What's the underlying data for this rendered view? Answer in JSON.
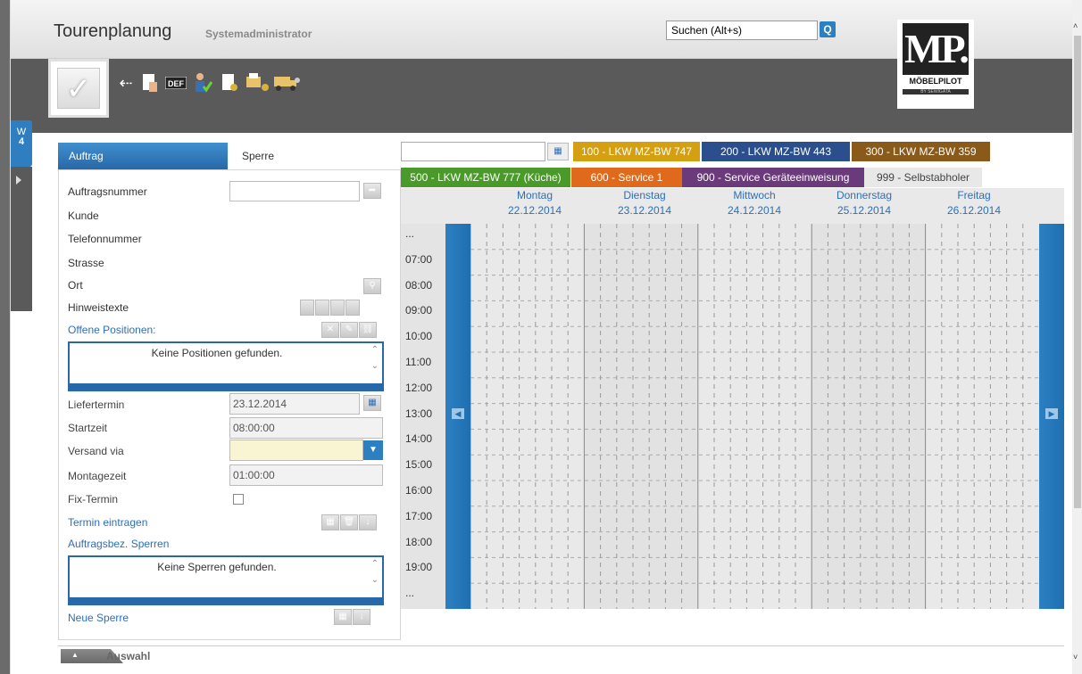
{
  "header": {
    "title": "Tourenplanung",
    "user": "Systemadministrator",
    "search_value": "Suchen (Alt+s)"
  },
  "logo": {
    "mp": "MP.",
    "name": "MÖBELPILOT",
    "sub": "BY SEWIGATA"
  },
  "side_tab": {
    "label_w": "W",
    "label_n": "4"
  },
  "tabs": {
    "auftrag": "Auftrag",
    "sperre": "Sperre"
  },
  "form": {
    "auftragsnummer": "Auftragsnummer",
    "kunde": "Kunde",
    "telefonnummer": "Telefonnummer",
    "strasse": "Strasse",
    "ort": "Ort",
    "hinweistexte": "Hinweistexte",
    "offene_positionen": "Offene Positionen:",
    "keine_positionen": "Keine Positionen gefunden.",
    "liefertermin": "Liefertermin",
    "liefertermin_value": "23.12.2014",
    "startzeit": "Startzeit",
    "startzeit_value": "08:00:00",
    "versand_via": "Versand via",
    "montagezeit": "Montagezeit",
    "montagezeit_value": "01:00:00",
    "fix_termin": "Fix-Termin",
    "termin_eintragen": "Termin eintragen",
    "auftragsbez_sperren": "Auftragsbez. Sperren",
    "keine_sperren": "Keine Sperren gefunden.",
    "neue_sperre": "Neue Sperre"
  },
  "tours": [
    {
      "label": "100 - LKW MZ-BW 747",
      "color": "#d4a012"
    },
    {
      "label": "200 - LKW MZ-BW 443",
      "color": "#2a4f8c"
    },
    {
      "label": "300 - LKW MZ-BW 359",
      "color": "#8a5a1a"
    },
    {
      "label": "500 - LKW MZ-BW 777 (Küche)",
      "color": "#4a9a2a"
    },
    {
      "label": "600 - Service 1",
      "color": "#e06a1c"
    },
    {
      "label": "900 - Service Geräteeinweisung",
      "color": "#6a3a7a"
    },
    {
      "label": "999 - Selbstabholer",
      "color": "#e8e8e8"
    }
  ],
  "days": [
    {
      "name": "Montag",
      "date": "22.12.2014"
    },
    {
      "name": "Dienstag",
      "date": "23.12.2014"
    },
    {
      "name": "Mittwoch",
      "date": "24.12.2014"
    },
    {
      "name": "Donnerstag",
      "date": "25.12.2014"
    },
    {
      "name": "Freitag",
      "date": "26.12.2014"
    }
  ],
  "times": [
    "...",
    "07:00",
    "08:00",
    "09:00",
    "10:00",
    "11:00",
    "12:00",
    "13:00",
    "14:00",
    "15:00",
    "16:00",
    "17:00",
    "18:00",
    "19:00",
    "..."
  ],
  "bottom": {
    "auswahl": "Auswahl"
  }
}
